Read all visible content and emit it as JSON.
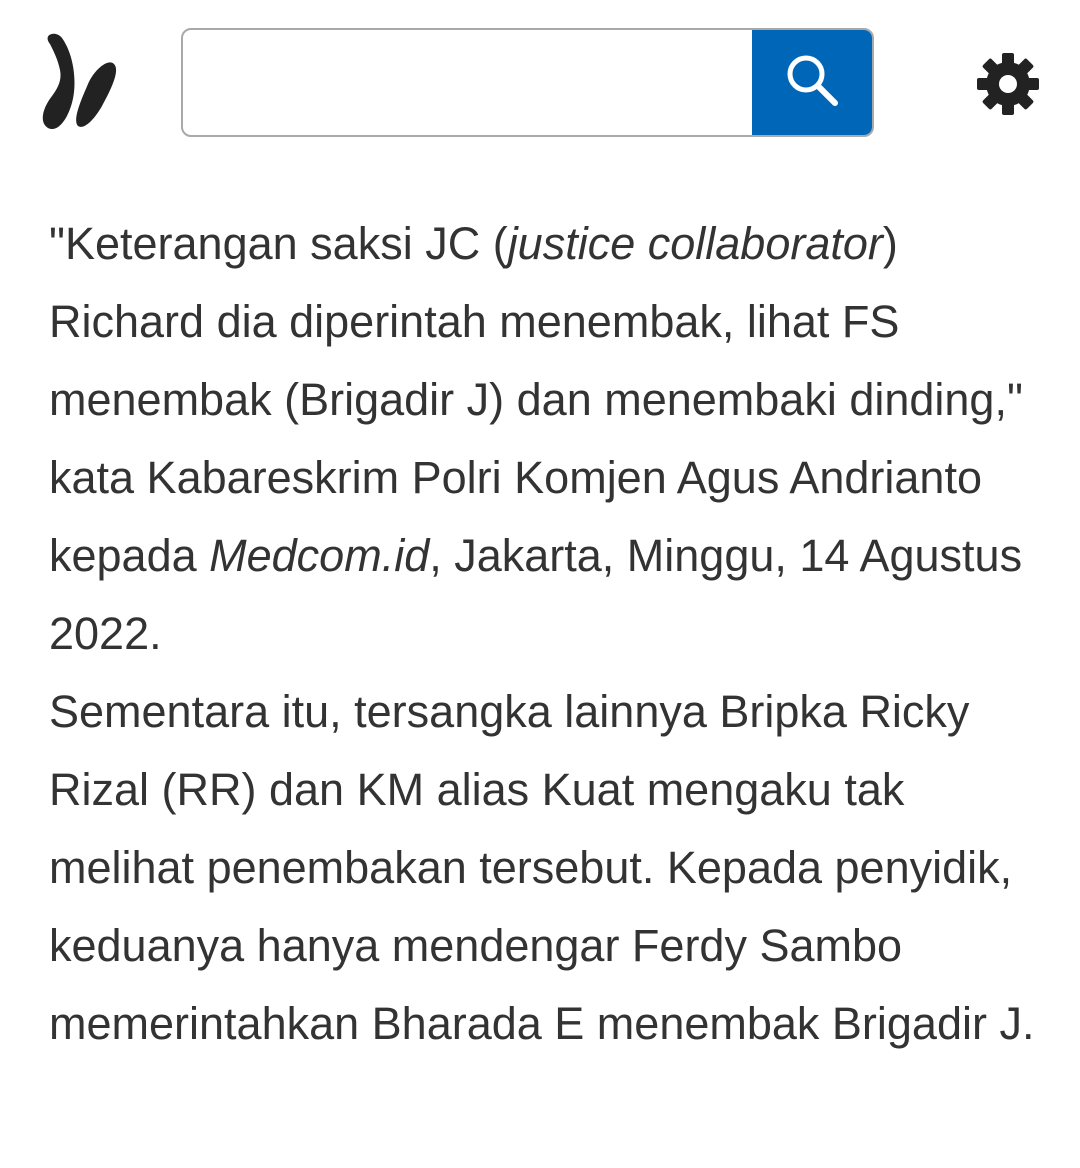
{
  "header": {
    "logo_icon": "msn-butterfly-icon",
    "search": {
      "value": "",
      "placeholder": "",
      "button_icon": "search-icon",
      "button_color": "#0067b8"
    },
    "settings_icon": "gear-icon"
  },
  "article": {
    "quote_open": "\"Keterangan saksi JC (",
    "quote_italic": "justice collaborator",
    "quote_mid": ") Richard dia diperintah menembak, lihat FS menembak (Brigadir J) dan menembaki dinding,\" kata Kabareskrim Polri Komjen Agus Andrianto kepada ",
    "source_italic": "Medcom.id",
    "quote_end": ", Jakarta, Minggu, 14 Agustus 2022.",
    "paragraph2": "Sementara itu, tersangka lainnya Bripka Ricky Rizal (RR) dan KM alias Kuat mengaku tak melihat penembakan tersebut. Kepada penyidik, keduanya hanya mendengar Ferdy Sambo memerintahkan Bharada E menembak Brigadir J."
  },
  "colors": {
    "text": "#333333",
    "accent": "#0067b8",
    "icon": "#222222"
  }
}
